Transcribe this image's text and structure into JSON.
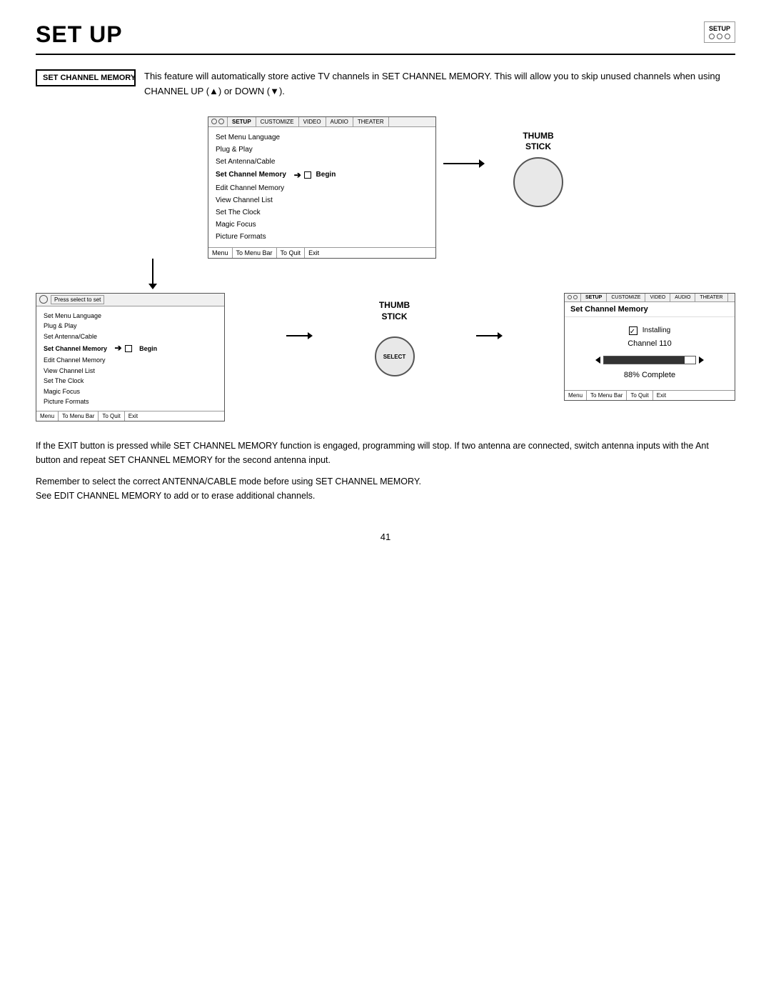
{
  "header": {
    "title": "SET UP",
    "setup_label": "SETUP"
  },
  "intro": {
    "badge_label": "SET CHANNEL MEMORY",
    "text": "This feature will automatically store active TV channels in SET CHANNEL MEMORY.  This will allow you to skip unused channels when using CHANNEL UP (▲) or DOWN (▼)."
  },
  "top_tv": {
    "tabs": [
      "SETUP",
      "CUSTOMIZE",
      "VIDEO",
      "AUDIO",
      "THEATER"
    ],
    "menu_items": [
      {
        "label": "Set Menu Language",
        "active": false
      },
      {
        "label": "Plug & Play",
        "active": false
      },
      {
        "label": "Set Antenna/Cable",
        "active": false
      },
      {
        "label": "Set Channel Memory",
        "active": true,
        "has_arrow": true,
        "has_square": true,
        "suffix": "Begin"
      },
      {
        "label": "Edit Channel Memory",
        "active": false
      },
      {
        "label": "View Channel List",
        "active": false
      },
      {
        "label": "Set The Clock",
        "active": false
      },
      {
        "label": "Magic Focus",
        "active": false
      },
      {
        "label": "Picture Formats",
        "active": false
      }
    ],
    "footer": [
      "Menu",
      "To Menu Bar",
      "To Quit",
      "Exit"
    ]
  },
  "thumb_stick": {
    "label": "THUMB\nSTICK"
  },
  "bottom_left_tv": {
    "press_select": "Press select to set",
    "menu_items": [
      {
        "label": "Set Menu Language",
        "active": false
      },
      {
        "label": "Plug & Play",
        "active": false
      },
      {
        "label": "Set Antenna/Cable",
        "active": false
      },
      {
        "label": "Set Channel Memory",
        "active": true,
        "suffix": "Begin"
      },
      {
        "label": "Edit Channel Memory",
        "active": false
      },
      {
        "label": "View Channel List",
        "active": false
      },
      {
        "label": "Set The Clock",
        "active": false
      },
      {
        "label": "Magic Focus",
        "active": false
      },
      {
        "label": "Picture Formats",
        "active": false
      }
    ],
    "footer": [
      "Menu",
      "To Menu Bar",
      "To Quit",
      "Exit"
    ]
  },
  "select_button": {
    "label": "SELECT"
  },
  "bottom_right_tv": {
    "tabs": [
      "SETUP",
      "CUSTOMIZE",
      "VIDEO",
      "AUDIO",
      "THEATER"
    ],
    "title": "Set Channel Memory",
    "installing_label": "Installing",
    "channel_label": "Channel 110",
    "progress_percent": 88,
    "progress_text": "88% Complete",
    "footer": [
      "Menu",
      "To Menu Bar",
      "To Quit",
      "Exit"
    ]
  },
  "body_paragraphs": [
    "If the EXIT button is pressed while SET CHANNEL MEMORY function is engaged, programming will stop.  If two antenna are connected, switch antenna inputs with the Ant button and repeat SET CHANNEL MEMORY for the second antenna input.",
    "Remember to select the correct ANTENNA/CABLE mode before using SET CHANNEL MEMORY.\nSee EDIT CHANNEL MEMORY to add or to erase additional channels."
  ],
  "page_number": "41"
}
